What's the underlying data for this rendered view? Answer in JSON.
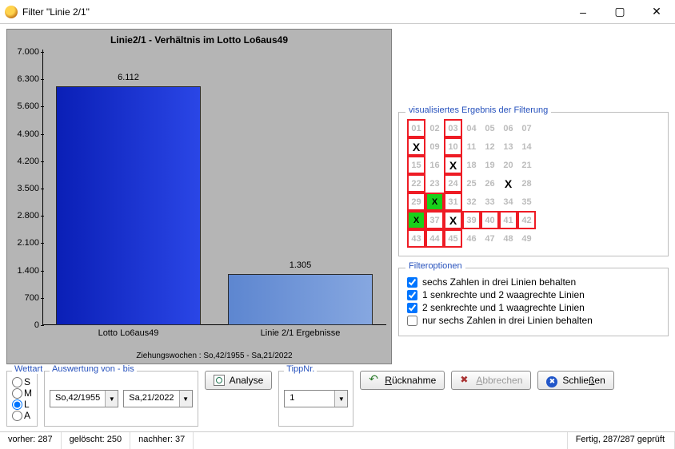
{
  "window": {
    "title": "Filter \"Linie 2/1\""
  },
  "chart_data": {
    "type": "bar",
    "title": "Linie2/1 - Verhältnis im Lotto Lo6aus49",
    "categories": [
      "Lotto Lo6aus49",
      "Linie 2/1 Ergebnisse"
    ],
    "values": [
      6112,
      1305
    ],
    "value_labels": [
      "6.112",
      "1.305"
    ],
    "yticks": [
      0,
      700,
      1400,
      2100,
      2800,
      3500,
      4200,
      4900,
      5600,
      6300,
      7000
    ],
    "ytick_labels": [
      "0",
      "700",
      "1.400",
      "2.100",
      "2.800",
      "3.500",
      "4.200",
      "4.900",
      "5.600",
      "6.300",
      "7.000"
    ],
    "ylim": [
      0,
      7000
    ],
    "colors": [
      "#0a1fb6",
      "#5d86d0"
    ],
    "subcaption": "Ziehungswochen : So,42/1955 - Sa,21/2022"
  },
  "vis": {
    "legend": "visualisiertes Ergebnis der Filterung",
    "grid": [
      [
        {
          "n": "01",
          "red": true
        },
        {
          "n": "02"
        },
        {
          "n": "03",
          "red": true
        },
        {
          "n": "04"
        },
        {
          "n": "05"
        },
        {
          "n": "06"
        },
        {
          "n": "07"
        }
      ],
      [
        {
          "n": "X",
          "red": true,
          "xb": true
        },
        {
          "n": "09"
        },
        {
          "n": "10",
          "red": true
        },
        {
          "n": "11"
        },
        {
          "n": "12"
        },
        {
          "n": "13"
        },
        {
          "n": "14"
        }
      ],
      [
        {
          "n": "15",
          "red": true
        },
        {
          "n": "16"
        },
        {
          "n": "X",
          "red": true,
          "xb": true
        },
        {
          "n": "18"
        },
        {
          "n": "19"
        },
        {
          "n": "20"
        },
        {
          "n": "21"
        }
      ],
      [
        {
          "n": "22",
          "red": true
        },
        {
          "n": "23"
        },
        {
          "n": "24",
          "red": true
        },
        {
          "n": "25"
        },
        {
          "n": "26"
        },
        {
          "n": "X",
          "xb": true
        },
        {
          "n": "28"
        }
      ],
      [
        {
          "n": "29",
          "red": true
        },
        {
          "n": "X",
          "red": true,
          "green": true
        },
        {
          "n": "31",
          "red": true
        },
        {
          "n": "32"
        },
        {
          "n": "33"
        },
        {
          "n": "34"
        },
        {
          "n": "35"
        }
      ],
      [
        {
          "n": "X",
          "red": true,
          "green": true
        },
        {
          "n": "37",
          "red": true
        },
        {
          "n": "X",
          "red": true,
          "xb": true
        },
        {
          "n": "39",
          "red": true
        },
        {
          "n": "40",
          "red": true
        },
        {
          "n": "41",
          "red": true
        },
        {
          "n": "42",
          "red": true
        }
      ],
      [
        {
          "n": "43",
          "red": true
        },
        {
          "n": "44",
          "red": true
        },
        {
          "n": "45",
          "red": true
        },
        {
          "n": "46"
        },
        {
          "n": "47"
        },
        {
          "n": "48"
        },
        {
          "n": "49"
        }
      ]
    ]
  },
  "filteropts": {
    "legend": "Filteroptionen",
    "items": [
      {
        "label": "sechs Zahlen in drei Linien behalten",
        "checked": true
      },
      {
        "label": "1 senkrechte und 2 waagrechte Linien",
        "checked": true
      },
      {
        "label": "2 senkrechte und 1 waagrechte Linien",
        "checked": true
      },
      {
        "label": "nur sechs Zahlen in drei Linien behalten",
        "checked": false
      }
    ]
  },
  "wettart": {
    "legend": "Wettart",
    "opts": [
      "S",
      "M",
      "L",
      "A"
    ],
    "selected": "L"
  },
  "range": {
    "legend": "Auswertung von - bis",
    "from": "So,42/1955",
    "to": "Sa,21/2022"
  },
  "tipp": {
    "legend": "TippNr.",
    "value": "1"
  },
  "buttons": {
    "analyse": "Analyse",
    "undo": "Rücknahme",
    "cancel": "Abbrechen",
    "close": "Schließen"
  },
  "underline": {
    "undo": "R",
    "cancel": "A",
    "close": "ß"
  },
  "status": {
    "before_lbl": "vorher:",
    "before": "287",
    "deleted_lbl": "gelöscht:",
    "deleted": "250",
    "after_lbl": "nachher:",
    "after": "37",
    "right": "Fertig, 287/287 geprüft"
  }
}
